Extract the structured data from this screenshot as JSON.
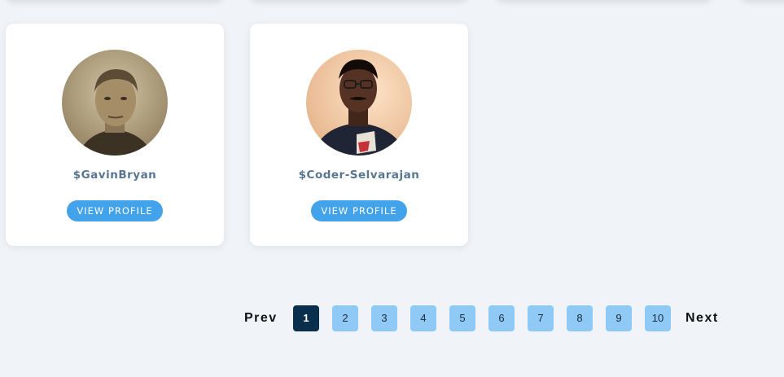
{
  "cards": [
    {
      "username": "$GavinBryan",
      "button_label": "VIEW PROFILE",
      "avatar_icon": "user-photo-avatar"
    },
    {
      "username": "$Coder-Selvarajan",
      "button_label": "VIEW PROFILE",
      "avatar_icon": "user-photo-avatar"
    }
  ],
  "pagination": {
    "prev_label": "Prev",
    "next_label": "Next",
    "pages": [
      "1",
      "2",
      "3",
      "4",
      "5",
      "6",
      "7",
      "8",
      "9",
      "10"
    ],
    "current_page": "1"
  },
  "colors": {
    "background": "#f0f4f8",
    "card": "#ffffff",
    "username": "#587692",
    "button": "#42a2ea",
    "page_inactive": "#8fcaf7",
    "page_active": "#0a2f4c"
  }
}
